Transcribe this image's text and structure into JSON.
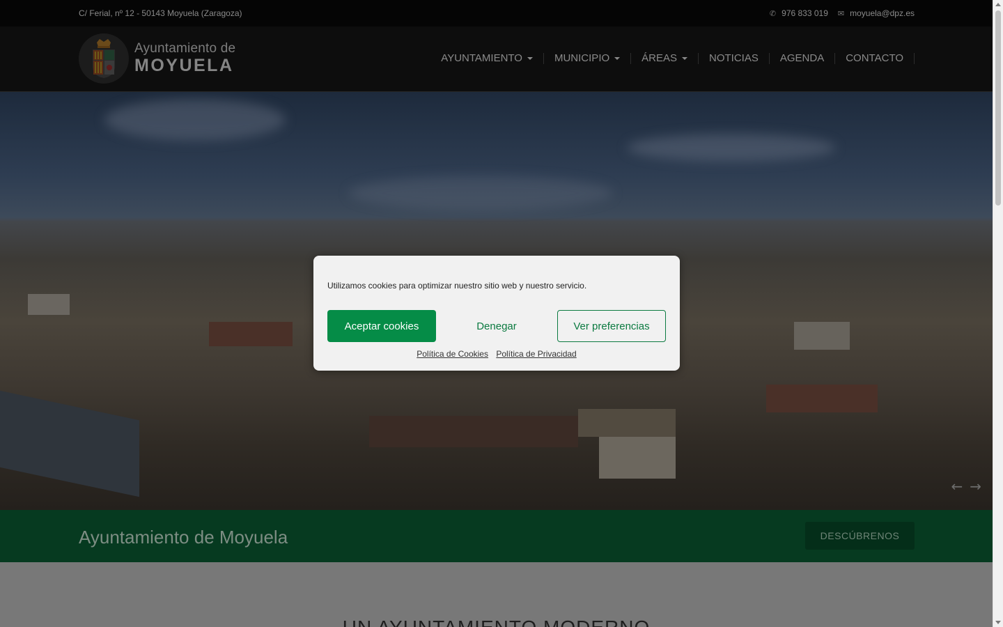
{
  "topbar": {
    "address": "C/ Ferial, nº 12 - 50143 Moyuela (Zaragoza)",
    "phone": "976 833 019",
    "email": "moyuela@dpz.es",
    "phone_icon": "phone-icon",
    "email_icon": "envelope-icon"
  },
  "logo": {
    "line1": "Ayuntamiento de",
    "line2": "MOYUELA"
  },
  "nav": {
    "items": [
      {
        "label": "AYUNTAMIENTO",
        "dropdown": true
      },
      {
        "label": "MUNICIPIO",
        "dropdown": true
      },
      {
        "label": "ÁREAS",
        "dropdown": true
      },
      {
        "label": "NOTICIAS",
        "dropdown": false
      },
      {
        "label": "AGENDA",
        "dropdown": false
      },
      {
        "label": "CONTACTO",
        "dropdown": false
      }
    ]
  },
  "hero": {
    "prev_arrow": "←",
    "next_arrow": "→"
  },
  "band": {
    "title": "Ayuntamiento de Moyuela",
    "button": "DESCÚBRENOS"
  },
  "content": {
    "heading": "UN AYUNTAMIENTO MODERNO"
  },
  "cookie": {
    "message": "Utilizamos cookies para optimizar nuestro sitio web y nuestro servicio.",
    "accept": "Aceptar cookies",
    "deny": "Denegar",
    "preferences": "Ver preferencias",
    "cookie_policy": "Política de Cookies",
    "privacy_policy": "Política de Privacidad"
  },
  "colors": {
    "accent_green": "#058c47",
    "band_green": "#063a20"
  }
}
